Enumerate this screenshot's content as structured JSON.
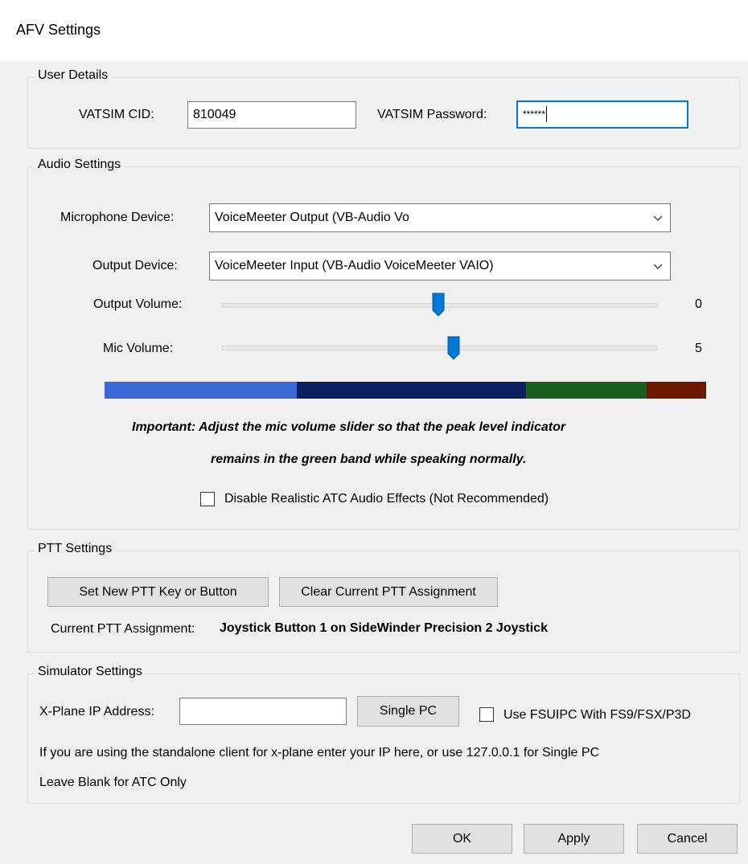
{
  "window": {
    "title": "AFV Settings"
  },
  "user_details": {
    "legend": "User Details",
    "cid_label": "VATSIM CID:",
    "cid_value": "810049",
    "password_label": "VATSIM Password:",
    "password_value": "******"
  },
  "audio": {
    "legend": "Audio Settings",
    "mic_device_label": "Microphone Device:",
    "mic_device_value": "VoiceMeeter Output (VB-Audio Vo",
    "output_device_label": "Output Device:",
    "output_device_value": "VoiceMeeter Input (VB-Audio VoiceMeeter VAIO)",
    "output_volume_label": "Output Volume:",
    "output_volume_value": "0",
    "mic_volume_label": "Mic Volume:",
    "mic_volume_value": "5",
    "meter_colors": [
      "#3c68d8",
      "#0c1f5e",
      "#1a5e20",
      "#6b1a00"
    ],
    "important_line1": "Important: Adjust the mic volume slider so that the peak level indicator",
    "important_line2": "remains in the green band while speaking normally.",
    "disable_effects_label": "Disable Realistic ATC Audio Effects (Not Recommended)",
    "disable_effects_checked": false
  },
  "ptt": {
    "legend": "PTT Settings",
    "set_button": "Set New PTT Key or Button",
    "clear_button": "Clear Current PTT Assignment",
    "current_label": "Current PTT Assignment:",
    "current_value": "Joystick Button 1 on SideWinder Precision 2 Joystick"
  },
  "simulator": {
    "legend": "Simulator Settings",
    "xplane_ip_label": "X-Plane IP Address:",
    "xplane_ip_value": "",
    "single_pc_button": "Single PC",
    "fsuipc_label": "Use FSUIPC With FS9/FSX/P3D",
    "fsuipc_checked": false,
    "help_line1": "If you are using the standalone client for x-plane enter your IP here, or use 127.0.0.1 for Single PC",
    "help_line2": "Leave Blank for ATC Only"
  },
  "footer": {
    "ok_button": "OK",
    "apply_button": "Apply",
    "cancel_button": "Cancel"
  },
  "accent_color": "#0078d7"
}
